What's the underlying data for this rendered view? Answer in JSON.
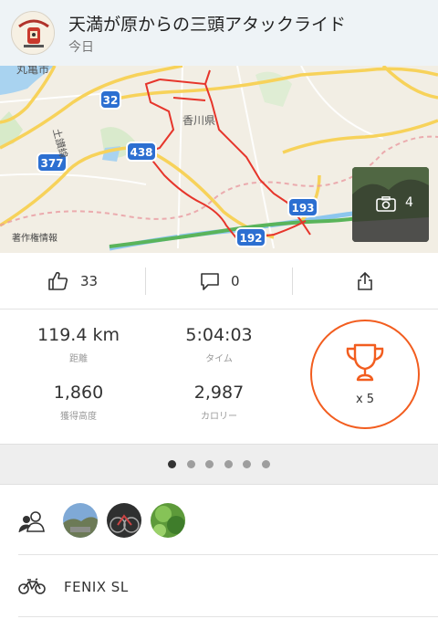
{
  "activity": {
    "title": "天満が原からの三頭アタックライド",
    "date": "今日"
  },
  "map": {
    "copyright": "著作権情報",
    "place_labels": [
      "丸亀市",
      "土讃線",
      "香川県"
    ],
    "route_shields": [
      "32",
      "377",
      "438",
      "193",
      "192"
    ],
    "photo_count": "4"
  },
  "actions": {
    "kudos_count": "33",
    "comment_count": "0"
  },
  "stats": {
    "distance": {
      "value": "119.4 km",
      "label": "距離"
    },
    "time": {
      "value": "5:04:03",
      "label": "タイム"
    },
    "elevation": {
      "value": "1,860",
      "label": "獲得高度"
    },
    "calories": {
      "value": "2,987",
      "label": "カロリー"
    },
    "achievements": "x 5"
  },
  "pager": {
    "count": 6,
    "active": 0
  },
  "gear": {
    "name": "FENIX SL"
  },
  "colors": {
    "accent": "#f25d1f",
    "route": "#e6352b",
    "header_bg": "#eef3f6"
  }
}
